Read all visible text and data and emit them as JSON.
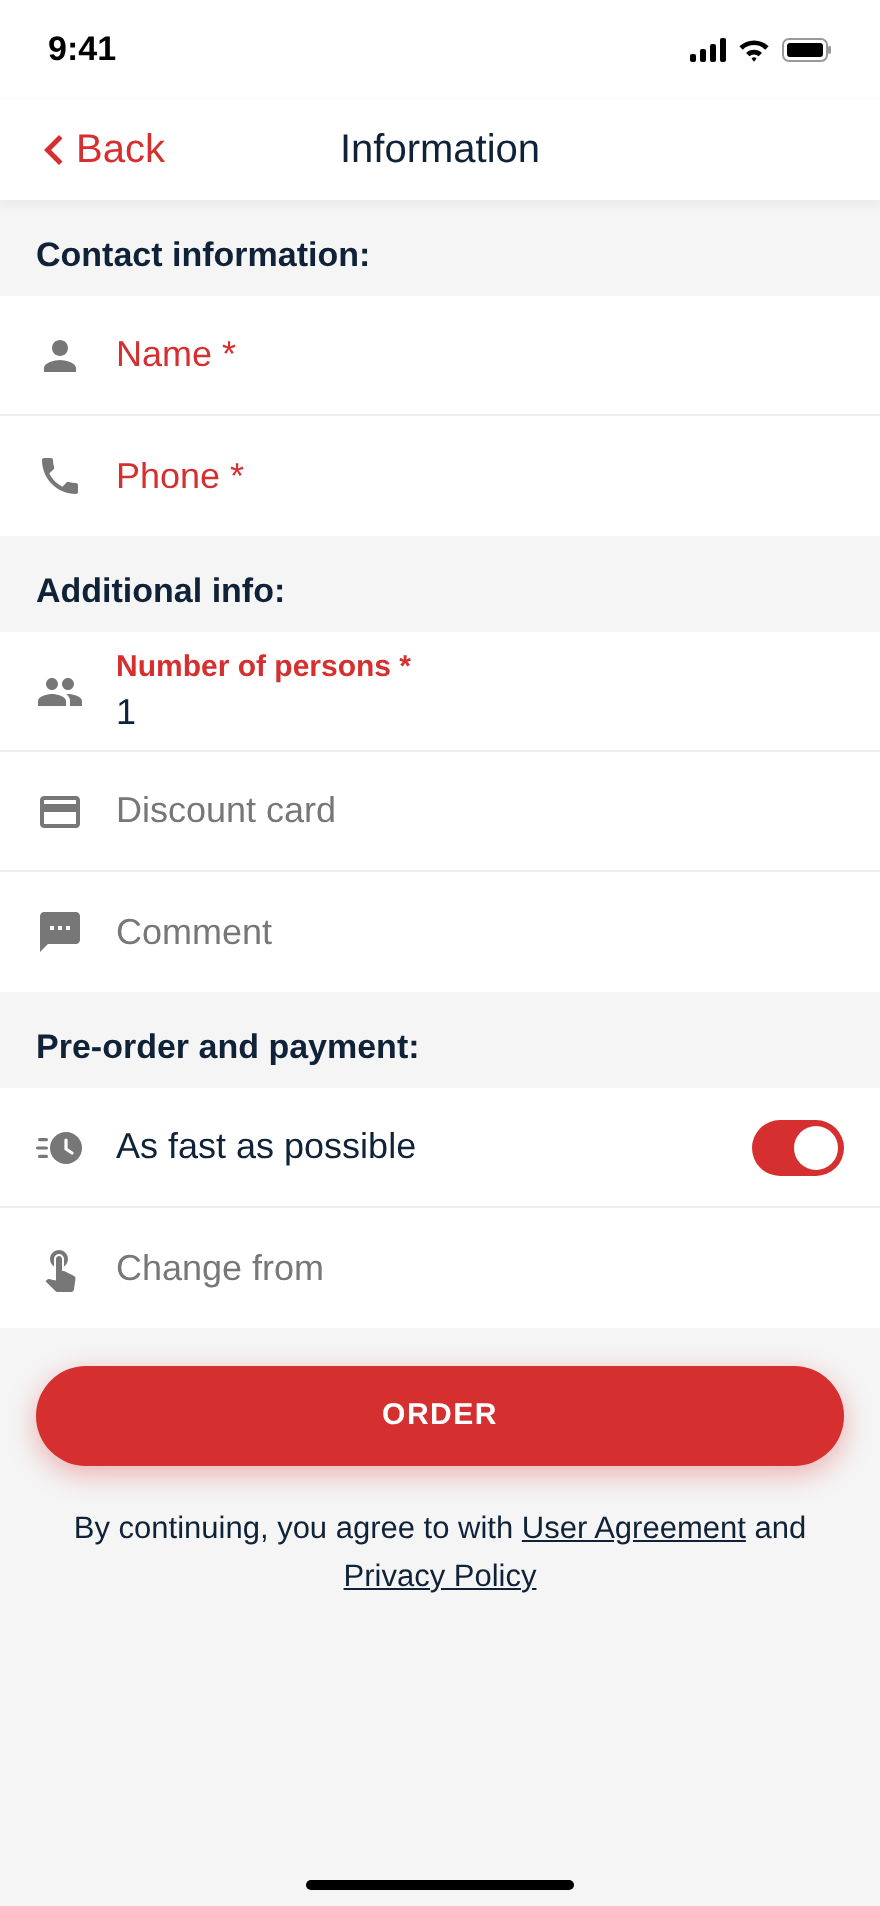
{
  "status_bar": {
    "time": "9:41"
  },
  "nav": {
    "back": "Back",
    "title": "Information"
  },
  "sections": [
    {
      "title": "Contact information:",
      "rows": [
        {
          "kind": "field",
          "placeholder": "Name *",
          "required": true
        },
        {
          "kind": "field",
          "placeholder": "Phone *",
          "required": true
        }
      ]
    },
    {
      "title": "Additional info:",
      "rows": [
        {
          "kind": "filled",
          "label": "Number of persons *",
          "value": "1",
          "required": true
        },
        {
          "kind": "field",
          "placeholder": "Discount card",
          "required": false
        },
        {
          "kind": "field",
          "placeholder": "Comment",
          "required": false
        }
      ]
    },
    {
      "title": "Pre-order and payment:",
      "rows": [
        {
          "kind": "toggle",
          "label": "As fast as possible",
          "on": true
        },
        {
          "kind": "field",
          "placeholder": "Change from",
          "required": false
        }
      ]
    }
  ],
  "order_button": "ORDER",
  "legal": [
    {
      "kind": "text",
      "text": "By continuing, you agree to with "
    },
    {
      "kind": "link",
      "text": "User Agreement"
    },
    {
      "kind": "text",
      "text": " and "
    },
    {
      "kind": "link",
      "text": "Privacy Policy"
    }
  ]
}
